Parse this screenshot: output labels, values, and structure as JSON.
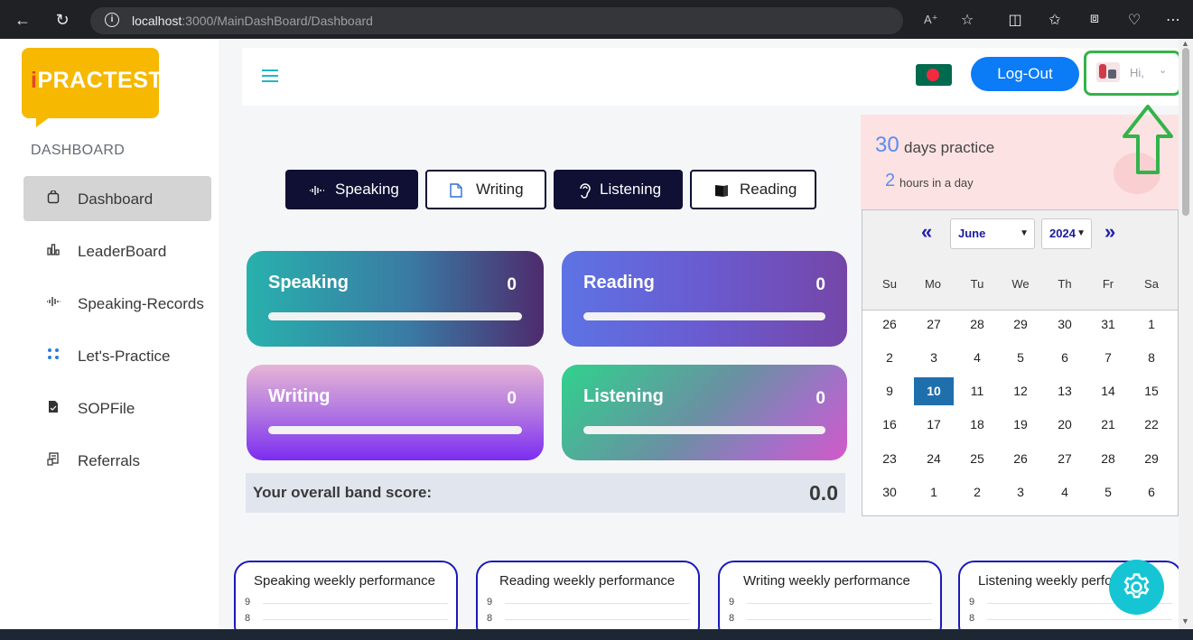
{
  "browser": {
    "url_host": "localhost",
    "url_path": ":3000/MainDashBoard/Dashboard"
  },
  "logo": {
    "i": "i",
    "rest": "PRACTEST"
  },
  "sidebar": {
    "heading": "DASHBOARD",
    "items": [
      {
        "label": "Dashboard",
        "icon": "bag-icon"
      },
      {
        "label": "LeaderBoard",
        "icon": "bar-chart-icon"
      },
      {
        "label": "Speaking-Records",
        "icon": "waveform-icon"
      },
      {
        "label": "Let's-Practice",
        "icon": "grid-dots-icon"
      },
      {
        "label": "SOPFile",
        "icon": "document-icon"
      },
      {
        "label": "Referrals",
        "icon": "referral-icon"
      }
    ]
  },
  "topbar": {
    "logout_label": "Log-Out",
    "greeting": "Hi,",
    "flag": "bangladesh-flag"
  },
  "skill_tabs": [
    {
      "label": "Speaking",
      "style": "dark"
    },
    {
      "label": "Writing",
      "style": "light"
    },
    {
      "label": "Listening",
      "style": "dark"
    },
    {
      "label": "Reading",
      "style": "light"
    }
  ],
  "score_cards": [
    {
      "title": "Speaking",
      "value": "0",
      "progress": 0
    },
    {
      "title": "Reading",
      "value": "0",
      "progress": 0
    },
    {
      "title": "Writing",
      "value": "0",
      "progress": 0
    },
    {
      "title": "Listening",
      "value": "0",
      "progress": 0
    }
  ],
  "band": {
    "label": "Your overall band score:",
    "value": "0.0"
  },
  "practice": {
    "days_num": "30",
    "days_text": "days practice",
    "hours_num": "2",
    "hours_text": "hours in a day"
  },
  "calendar": {
    "prev": "«",
    "next": "»",
    "month": "June",
    "year": "2024",
    "dow": [
      "Su",
      "Mo",
      "Tu",
      "We",
      "Th",
      "Fr",
      "Sa"
    ],
    "weeks": [
      [
        "26",
        "27",
        "28",
        "29",
        "30",
        "31",
        "1"
      ],
      [
        "2",
        "3",
        "4",
        "5",
        "6",
        "7",
        "8"
      ],
      [
        "9",
        "10",
        "11",
        "12",
        "13",
        "14",
        "15"
      ],
      [
        "16",
        "17",
        "18",
        "19",
        "20",
        "21",
        "22"
      ],
      [
        "23",
        "24",
        "25",
        "26",
        "27",
        "28",
        "29"
      ],
      [
        "30",
        "1",
        "2",
        "3",
        "4",
        "5",
        "6"
      ]
    ],
    "selected": "10"
  },
  "perf_cards": [
    {
      "title": "Speaking weekly performance",
      "ticks": [
        "9",
        "8"
      ]
    },
    {
      "title": "Reading weekly performance",
      "ticks": [
        "9",
        "8"
      ]
    },
    {
      "title": "Writing weekly performance",
      "ticks": [
        "9",
        "8"
      ]
    },
    {
      "title": "Listening weekly performance",
      "ticks": [
        "9",
        "8"
      ]
    }
  ],
  "colors": {
    "highlight_box": "#33b34a",
    "logout": "#0b7bf6",
    "selected_day": "#1f6fad",
    "gear_button": "#16c5d3"
  }
}
